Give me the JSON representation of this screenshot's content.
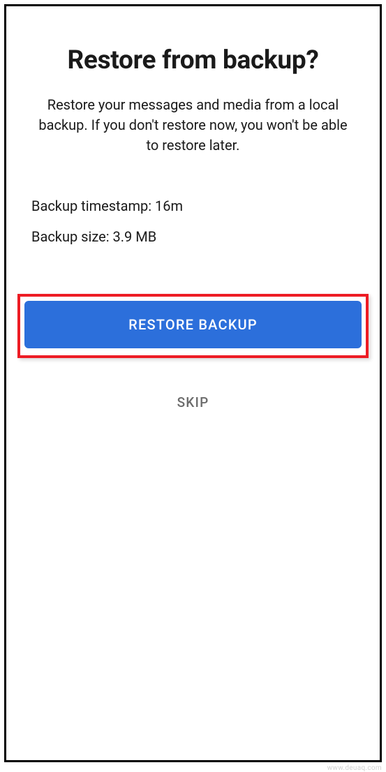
{
  "title": "Restore from backup?",
  "description": "Restore your messages and media from a local backup. If you don't restore now, you won't be able to restore later.",
  "backup": {
    "timestamp_label": "Backup timestamp: ",
    "timestamp_value": "16m",
    "size_label": "Backup size: ",
    "size_value": "3.9 MB"
  },
  "buttons": {
    "restore": "RESTORE BACKUP",
    "skip": "SKIP"
  },
  "watermark": "www.deuaq.com"
}
